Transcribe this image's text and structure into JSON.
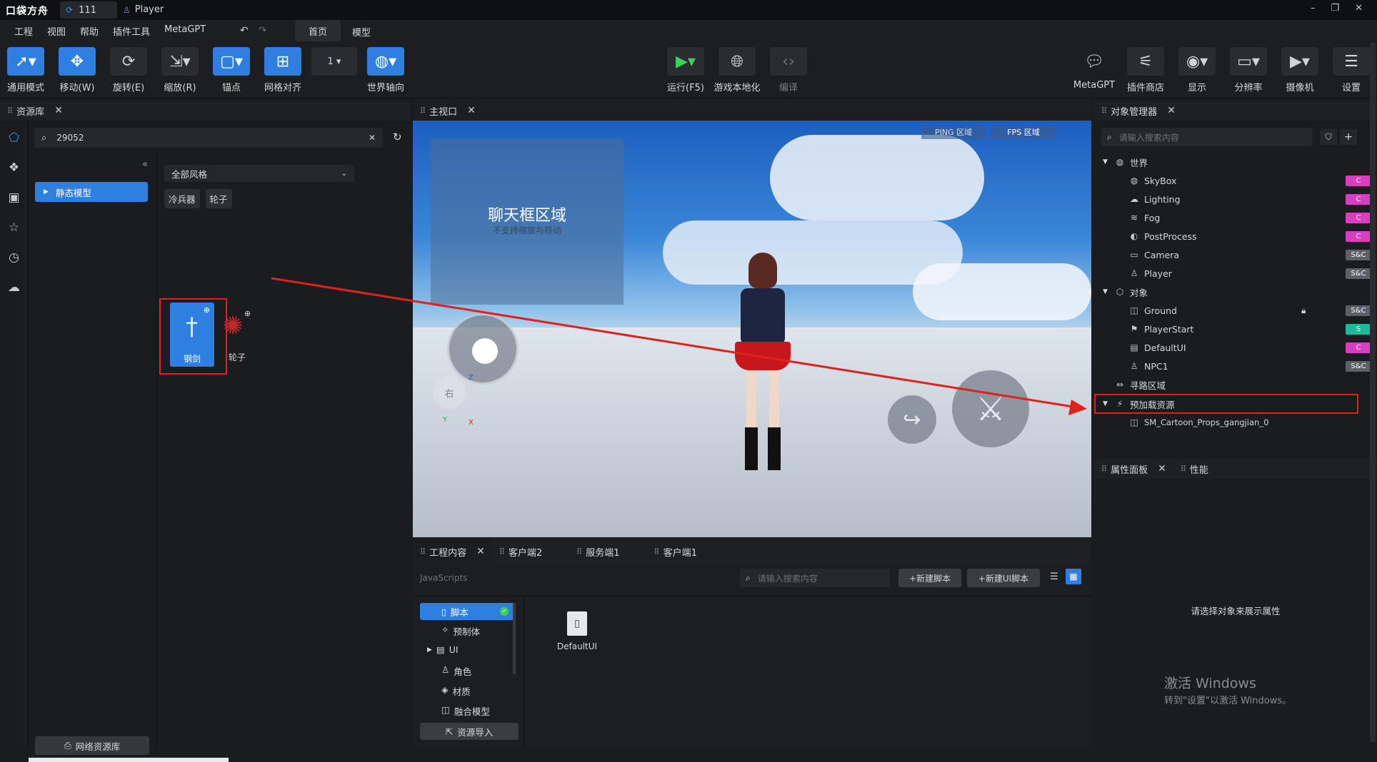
{
  "titlebar": {
    "logo": "口袋方舟",
    "project_tab": "111",
    "player_tab": "Player",
    "window_controls": [
      "–",
      "❐",
      "✕"
    ]
  },
  "menubar": {
    "items": [
      "工程",
      "视图",
      "帮助",
      "插件工具",
      "MetaGPT"
    ],
    "tabs": [
      "首页",
      "模型"
    ],
    "active_tab": "首页"
  },
  "toolbar": {
    "left": [
      {
        "label": "通用模式",
        "icon": "cursor-icon",
        "active": true
      },
      {
        "label": "移动(W)",
        "icon": "move-icon",
        "active": true
      },
      {
        "label": "旋转(E)",
        "icon": "rotate-icon",
        "active": false
      },
      {
        "label": "缩放(R)",
        "icon": "scale-icon",
        "active": false
      },
      {
        "label": "锚点",
        "icon": "anchor-icon",
        "active": true
      },
      {
        "label": "网格对齐",
        "icon": "grid-icon",
        "active": true
      },
      {
        "label": "",
        "icon": "number-icon",
        "value": "1"
      },
      {
        "label": "世界轴向",
        "icon": "world-axis-icon",
        "active": true
      }
    ],
    "center": [
      {
        "label": "运行(F5)",
        "icon": "play-icon"
      },
      {
        "label": "游戏本地化",
        "icon": "globe-icon"
      },
      {
        "label": "编译",
        "icon": "code-icon"
      }
    ],
    "right": [
      {
        "label": "MetaGPT",
        "icon": "chat-icon"
      },
      {
        "label": "插件商店",
        "icon": "plugin-icon"
      },
      {
        "label": "显示",
        "icon": "eye-icon"
      },
      {
        "label": "分辨率",
        "icon": "monitor-icon"
      },
      {
        "label": "摄像机",
        "icon": "camera-icon"
      },
      {
        "label": "设置",
        "icon": "settings-icon"
      }
    ]
  },
  "asset_panel": {
    "title": "资源库",
    "search_value": "29052",
    "category": "静态模型",
    "style_select": "全部风格",
    "tags": [
      "冷兵器",
      "轮子"
    ],
    "items": [
      {
        "label": "钢剑",
        "icon": "sword-icon"
      },
      {
        "label": "轮子",
        "icon": "wheel-icon"
      }
    ],
    "bottom_button": "网络资源库"
  },
  "viewport": {
    "title": "主视口",
    "ping_label": "PING 区域",
    "fps_label": "FPS 区域",
    "chat_area_title": "聊天框区域",
    "chat_area_sub": "不支持缩放与移动",
    "joystick_label": "右",
    "axis_z": "Z",
    "axis_x": "X",
    "axis_y": "Y"
  },
  "project_panel": {
    "tabs": [
      "工程内容",
      "客户端2",
      "服务端1",
      "客户端1"
    ],
    "breadcrumb": "JavaScripts",
    "search_placeholder": "请输入搜索内容",
    "new_script": "+新建脚本",
    "new_ui_script": "+新建UI脚本",
    "tree": [
      {
        "label": "脚本",
        "icon": "file-icon",
        "selected": true
      },
      {
        "label": "预制体",
        "icon": "prefab-icon"
      },
      {
        "label": "UI",
        "icon": "ui-icon",
        "expandable": true
      },
      {
        "label": "角色",
        "icon": "character-icon"
      },
      {
        "label": "材质",
        "icon": "material-icon"
      },
      {
        "label": "融合模型",
        "icon": "merge-icon"
      }
    ],
    "import_button": "资源导入",
    "file": {
      "label": "DefaultUI",
      "icon": "script-file-icon"
    }
  },
  "object_manager": {
    "title": "对象管理器",
    "search_placeholder": "请输入搜索内容",
    "rows": [
      {
        "label": "世界",
        "indent": 0,
        "arrow": true,
        "icon": "world-icon"
      },
      {
        "label": "SkyBox",
        "indent": 1,
        "icon": "skybox-icon",
        "badge": "C"
      },
      {
        "label": "Lighting",
        "indent": 1,
        "icon": "cloud-icon",
        "badge": "C"
      },
      {
        "label": "Fog",
        "indent": 1,
        "icon": "fog-icon",
        "badge": "C"
      },
      {
        "label": "PostProcess",
        "indent": 1,
        "icon": "palette-icon",
        "badge": "C"
      },
      {
        "label": "Camera",
        "indent": 1,
        "icon": "camera-icon",
        "badge": "S&C"
      },
      {
        "label": "Player",
        "indent": 1,
        "icon": "person-icon",
        "badge": "S&C"
      },
      {
        "label": "对象",
        "indent": 0,
        "arrow": true,
        "icon": "cube-icon"
      },
      {
        "label": "Ground",
        "indent": 1,
        "icon": "box-icon",
        "badge": "S&C",
        "lock": true
      },
      {
        "label": "PlayerStart",
        "indent": 1,
        "icon": "flag-icon",
        "badge": "S"
      },
      {
        "label": "DefaultUI",
        "indent": 1,
        "icon": "ui-icon",
        "badge": "C"
      },
      {
        "label": "NPC1",
        "indent": 1,
        "icon": "person-icon",
        "badge": "S&C"
      },
      {
        "label": "寻路区域",
        "indent": 0,
        "icon": "nav-icon"
      },
      {
        "label": "预加载资源",
        "indent": 0,
        "arrow": true,
        "icon": "preload-icon",
        "highlight": true
      },
      {
        "label": "SM_Cartoon_Props_gangjian_0",
        "indent": 1,
        "icon": "box-icon"
      }
    ]
  },
  "properties": {
    "tabs": [
      "属性面板",
      "性能"
    ],
    "empty_text": "请选择对象来展示属性"
  },
  "watermark": {
    "line1": "激活 Windows",
    "line2": "转到\"设置\"以激活 Windows。"
  },
  "colors": {
    "accent": "#2f7fe0",
    "badge_c": "#d63fbf",
    "badge_s": "#1fb89a",
    "badge_sc": "#5d6068",
    "highlight": "#e0221c"
  }
}
